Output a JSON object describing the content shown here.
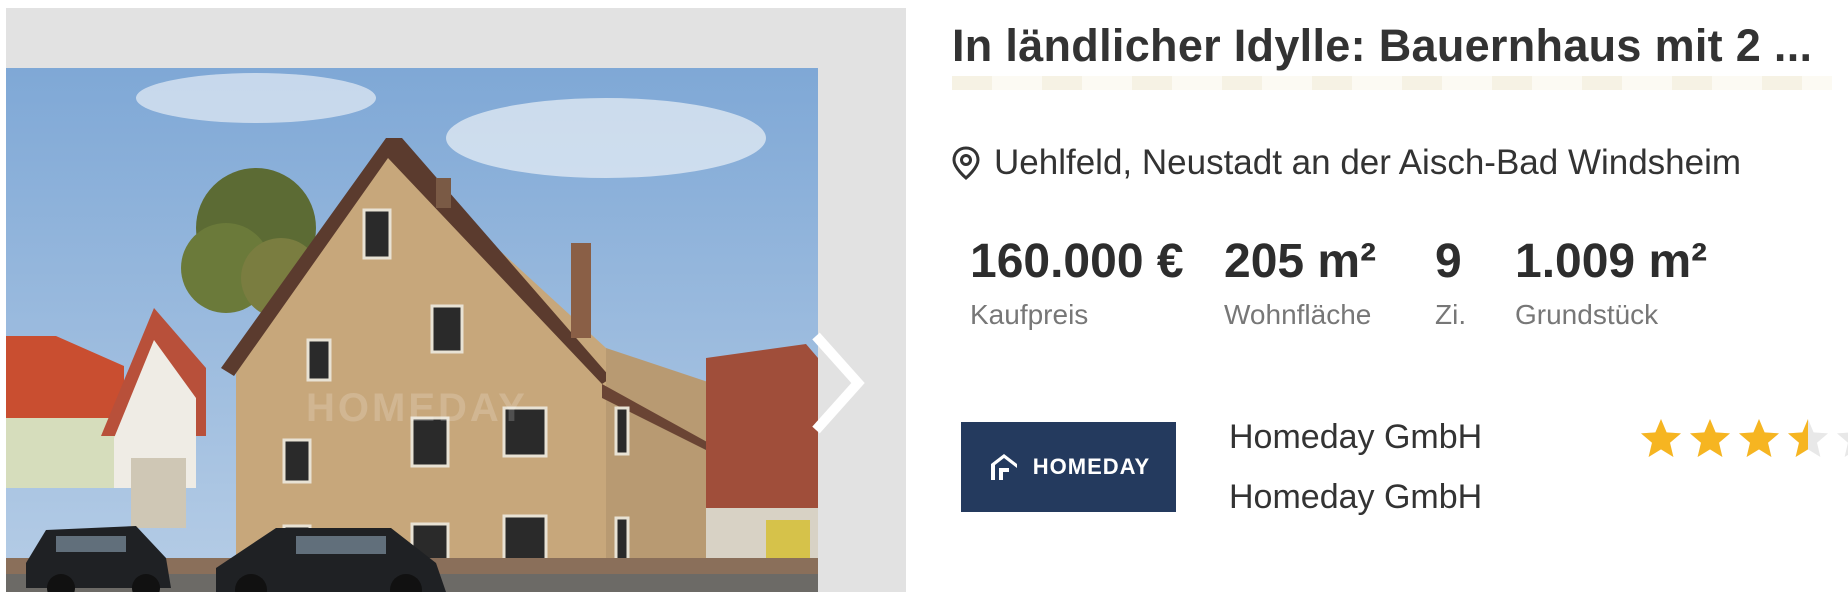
{
  "listing": {
    "title": "In ländlicher Idylle: Bauernhaus mit 2 ...",
    "location": "Uehlfeld, Neustadt an der Aisch-Bad Windsheim",
    "facts": [
      {
        "value": "160.000 €",
        "label": "Kaufpreis"
      },
      {
        "value": "205 m²",
        "label": "Wohnfläche"
      },
      {
        "value": "9",
        "label": "Zi."
      },
      {
        "value": "1.009 m²",
        "label": "Grundstück"
      }
    ]
  },
  "gallery": {
    "watermark": "HOMEDAY",
    "next_icon": "chevron-right-icon"
  },
  "agency": {
    "logo_text": "HOMEDAY",
    "name_line1": "Homeday GmbH",
    "name_line2": "Homeday GmbH",
    "rating": 3.5,
    "rating_max": 5
  },
  "colors": {
    "logo_bg": "#243a5e",
    "star": "#f6b521",
    "sky": "#8fb3d9"
  }
}
